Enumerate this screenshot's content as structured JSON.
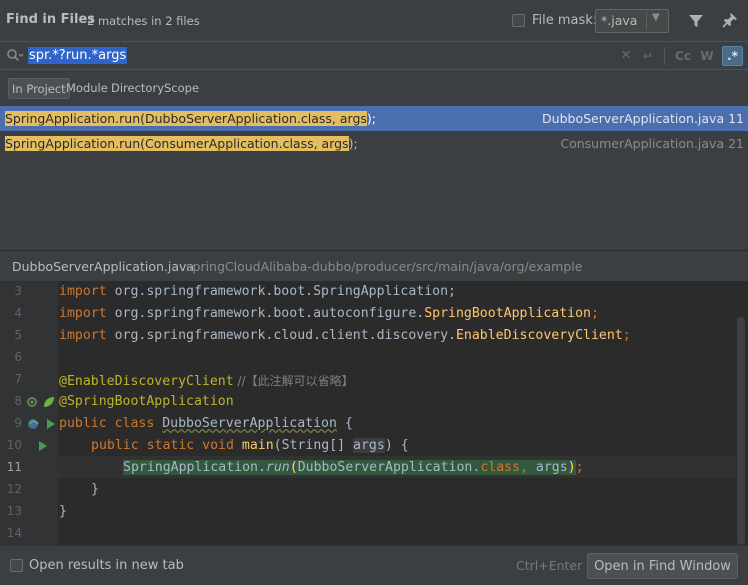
{
  "header": {
    "title": "Find in Files",
    "match_summary": "2 matches in 2 files",
    "file_mask_label": "File mask:",
    "file_mask_value": "*.java",
    "file_mask_checked": false
  },
  "search": {
    "query": "spr.*?run.*args",
    "regex_enabled": true,
    "toggles": {
      "match_case": "Cc",
      "words": "W",
      "regex": ".*"
    }
  },
  "scopes": [
    {
      "label": "In Project",
      "selected": true
    },
    {
      "label": "Module",
      "selected": false
    },
    {
      "label": "Directory",
      "selected": false
    },
    {
      "label": "Scope",
      "selected": false
    }
  ],
  "results": [
    {
      "match": "SpringApplication.run(DubboServerApplication.class, args",
      "rest": ");",
      "file": "DubboServerApplication.java",
      "line": "11",
      "selected": true
    },
    {
      "match": "SpringApplication.run(ConsumerApplication.class, args",
      "rest": ");",
      "file": "ConsumerApplication.java",
      "line": "21",
      "selected": false
    }
  ],
  "preview": {
    "file_name": "DubboServerApplication.java",
    "file_path": "springCloudAlibaba-dubbo/producer/src/main/java/org/example",
    "line_numbers": [
      "3",
      "4",
      "5",
      "6",
      "7",
      "8",
      "9",
      "10",
      "11",
      "12",
      "13",
      "14"
    ],
    "current_line": "11",
    "code": {
      "l3_kw": "import",
      "l3_rest": " org.springframework.boot.SpringApplication;",
      "l4_kw": "import",
      "l4_pkg": " org.springframework.boot.autoconfigure.",
      "l4_cls": "SpringBootApplication",
      "l4_end": ";",
      "l5_kw": "import",
      "l5_pkg": " org.springframework.cloud.client.discovery.",
      "l5_cls": "EnableDiscoveryClient",
      "l5_end": ";",
      "l7_ann": "@EnableDiscoveryClient",
      "l7_cm": " //【此注解可以省略】",
      "l8_ann": "@SpringBootApplication",
      "l9_kw": "public class",
      "l9_cls": "DubboServerApplication",
      "l9_brace": " {",
      "l10_kw": "public static void",
      "l10_fn": "main",
      "l10_params": "(String[] ",
      "l10_args": "args",
      "l10_end": ") {",
      "l11_cls": "SpringApplication.",
      "l11_run": "run",
      "l11_open": "(",
      "l11_arg1": "DubboServerApplication.",
      "l11_kw": "class",
      "l11_comma": ", ",
      "l11_args": "args",
      "l11_close": ")",
      "l11_end": ";",
      "l12": "}",
      "l13": "}"
    }
  },
  "footer": {
    "open_new_tab_label": "Open results in new tab",
    "open_new_tab_checked": false,
    "shortcut": "Ctrl+Enter",
    "open_button": "Open in Find Window"
  },
  "colors": {
    "panel_bg": "#3c3f41",
    "editor_bg": "#2b2b2b",
    "selection_blue": "#4b6eaf",
    "match_highlight": "#e5bd61",
    "keyword": "#cc7832",
    "annotation": "#bbb529"
  }
}
